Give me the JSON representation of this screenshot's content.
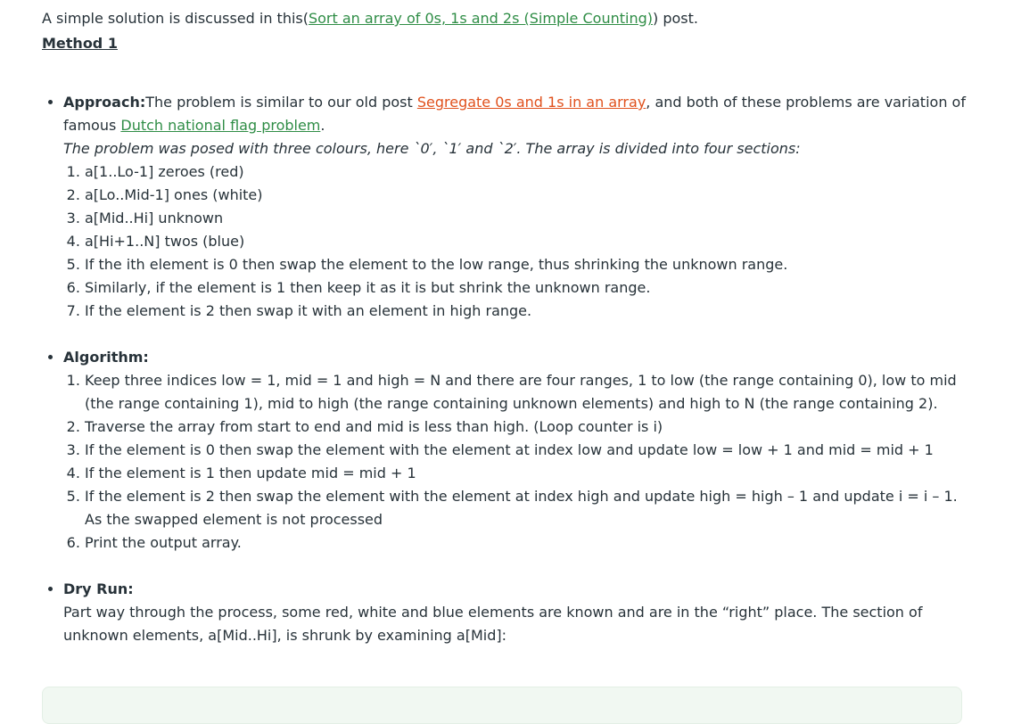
{
  "intro": {
    "prefix": "A simple solution is discussed in this(",
    "link": "Sort an array of 0s, 1s and 2s (Simple Counting)",
    "suffix": ") post."
  },
  "method_heading": "Method 1",
  "approach": {
    "label": "Approach:",
    "text1": "The problem is similar to our old post ",
    "link1": "Segregate 0s and 1s in an array",
    "text2": ", and both of these problems are variation of famous ",
    "link2": "Dutch national flag problem",
    "text3": ".",
    "italic": "The problem was posed with three colours, here `0′, `1′ and `2′. The array is divided into four sections:",
    "items": [
      "a[1..Lo-1] zeroes (red)",
      "a[Lo..Mid-1] ones (white)",
      "a[Mid..Hi] unknown",
      "a[Hi+1..N] twos (blue)",
      "If the ith element is 0 then swap the element to the low range, thus shrinking the unknown range.",
      "Similarly, if the element is 1 then keep it as it is but shrink the unknown range.",
      "If the element is 2 then swap it with an element in high range."
    ]
  },
  "algorithm": {
    "label": "Algorithm:",
    "items": [
      "Keep three indices low = 1, mid = 1 and high = N and there are four ranges, 1 to low (the range containing 0), low to mid (the range containing 1), mid to high (the range containing unknown elements) and high to N (the range containing 2).",
      "Traverse the array from start to end and mid is less than high. (Loop counter is i)",
      "If the element is 0 then swap the element with the element at index low and update low = low + 1 and mid = mid + 1",
      "If the element is 1 then update mid = mid + 1",
      "If the element is 2 then swap the element with the element at index high and update high = high – 1 and update i = i – 1. As the swapped element is not processed",
      "Print the output array."
    ]
  },
  "dry_run": {
    "label": "Dry Run:",
    "text": "Part way through the process, some red, white and blue elements are known and are in the “right” place. The section of unknown elements, a[Mid..Hi], is shrunk by examining a[Mid]:"
  },
  "colors": {
    "link_green": "#2f8d46",
    "link_orange": "#e0511d",
    "text": "#273239",
    "code_box_bg": "#f1f8f2"
  }
}
